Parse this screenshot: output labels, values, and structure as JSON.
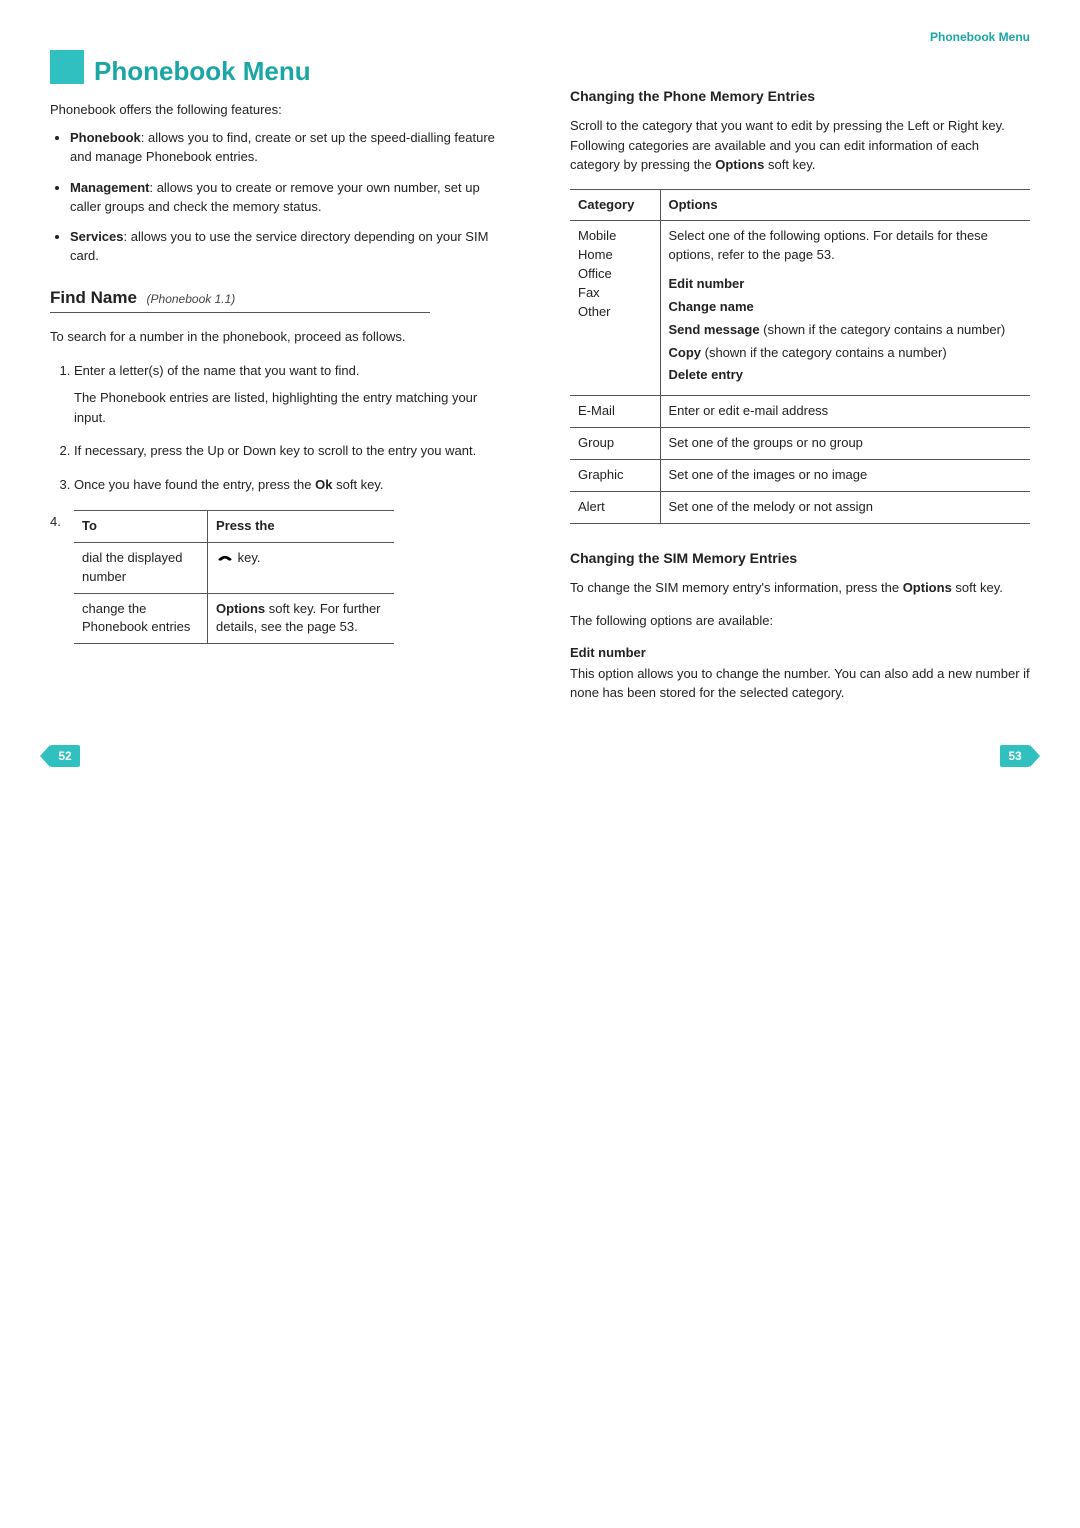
{
  "header_tag": "Phonebook Menu",
  "title": "Phonebook Menu",
  "left": {
    "intro": "Phonebook offers the following features:",
    "bullets": [
      {
        "term": "Phonebook",
        "desc": ": allows you to find, create or set up the speed-dialling feature and manage Phonebook entries."
      },
      {
        "term": "Management",
        "desc": ": allows you to create or remove your own number, set up caller groups and check the memory status."
      },
      {
        "term": "Services",
        "desc": ": allows you to use the service directory depending on your SIM card."
      }
    ],
    "section": {
      "name": "Find Name",
      "ref": "(Phonebook 1.1)"
    },
    "section_intro": "To search for a number in the phonebook, proceed as follows.",
    "steps": [
      {
        "main": "Enter a letter(s) of the name that you want to find.",
        "sub": "The Phonebook entries are listed, highlighting the entry matching your input."
      },
      {
        "main": "If necessary, press the Up or Down key to scroll to the entry you want."
      },
      {
        "main_pre": "Once you have found the entry, press the ",
        "main_bold": "Ok",
        "main_post": " soft key."
      }
    ],
    "step4_num": "4.",
    "table4": {
      "h1": "To",
      "h2": "Press the",
      "rows": [
        {
          "c1": "dial the displayed number",
          "c2_icon": true,
          "c2_text": " key."
        },
        {
          "c1": "change the Phonebook entries",
          "c2_bold": "Options",
          "c2_rest": " soft key. For further details, see the page 53."
        }
      ]
    }
  },
  "right": {
    "h1": "Changing the Phone Memory Entries",
    "p1_pre": "Scroll to the category that you want to edit by pressing the Left or Right key. Following categories are available and you can edit information of each category by pressing the ",
    "p1_bold": "Options",
    "p1_post": " soft key.",
    "cat_table": {
      "h1": "Category",
      "h2": "Options",
      "row1_cats": [
        "Mobile",
        "Home",
        "Office",
        "Fax",
        "Other"
      ],
      "row1_opts_intro": "Select one of the following options. For details for these options, refer to the page 53.",
      "row1_opts": [
        {
          "bold": "Edit number",
          "rest": ""
        },
        {
          "bold": "Change name",
          "rest": ""
        },
        {
          "bold": "Send message",
          "rest": " (shown if the category contains a number)"
        },
        {
          "bold": "Copy",
          "rest": " (shown if the category contains a number)"
        },
        {
          "bold": "Delete entry",
          "rest": ""
        }
      ],
      "rows_rest": [
        {
          "c1": "E-Mail",
          "c2": "Enter or edit e-mail address"
        },
        {
          "c1": "Group",
          "c2": "Set one of the groups or no group"
        },
        {
          "c1": "Graphic",
          "c2": "Set one of the images or no image"
        },
        {
          "c1": "Alert",
          "c2": "Set one of the melody or not assign"
        }
      ]
    },
    "h2": "Changing the SIM Memory Entries",
    "p2_pre": "To change the SIM memory entry's information, press the ",
    "p2_bold": "Options",
    "p2_post": " soft key.",
    "p3": "The following options are available:",
    "sub1_title": "Edit number",
    "sub1_body": "This option allows you to change the number. You can also add a new number if none has been stored for the selected category."
  },
  "pages": {
    "left": "52",
    "right": "53"
  }
}
